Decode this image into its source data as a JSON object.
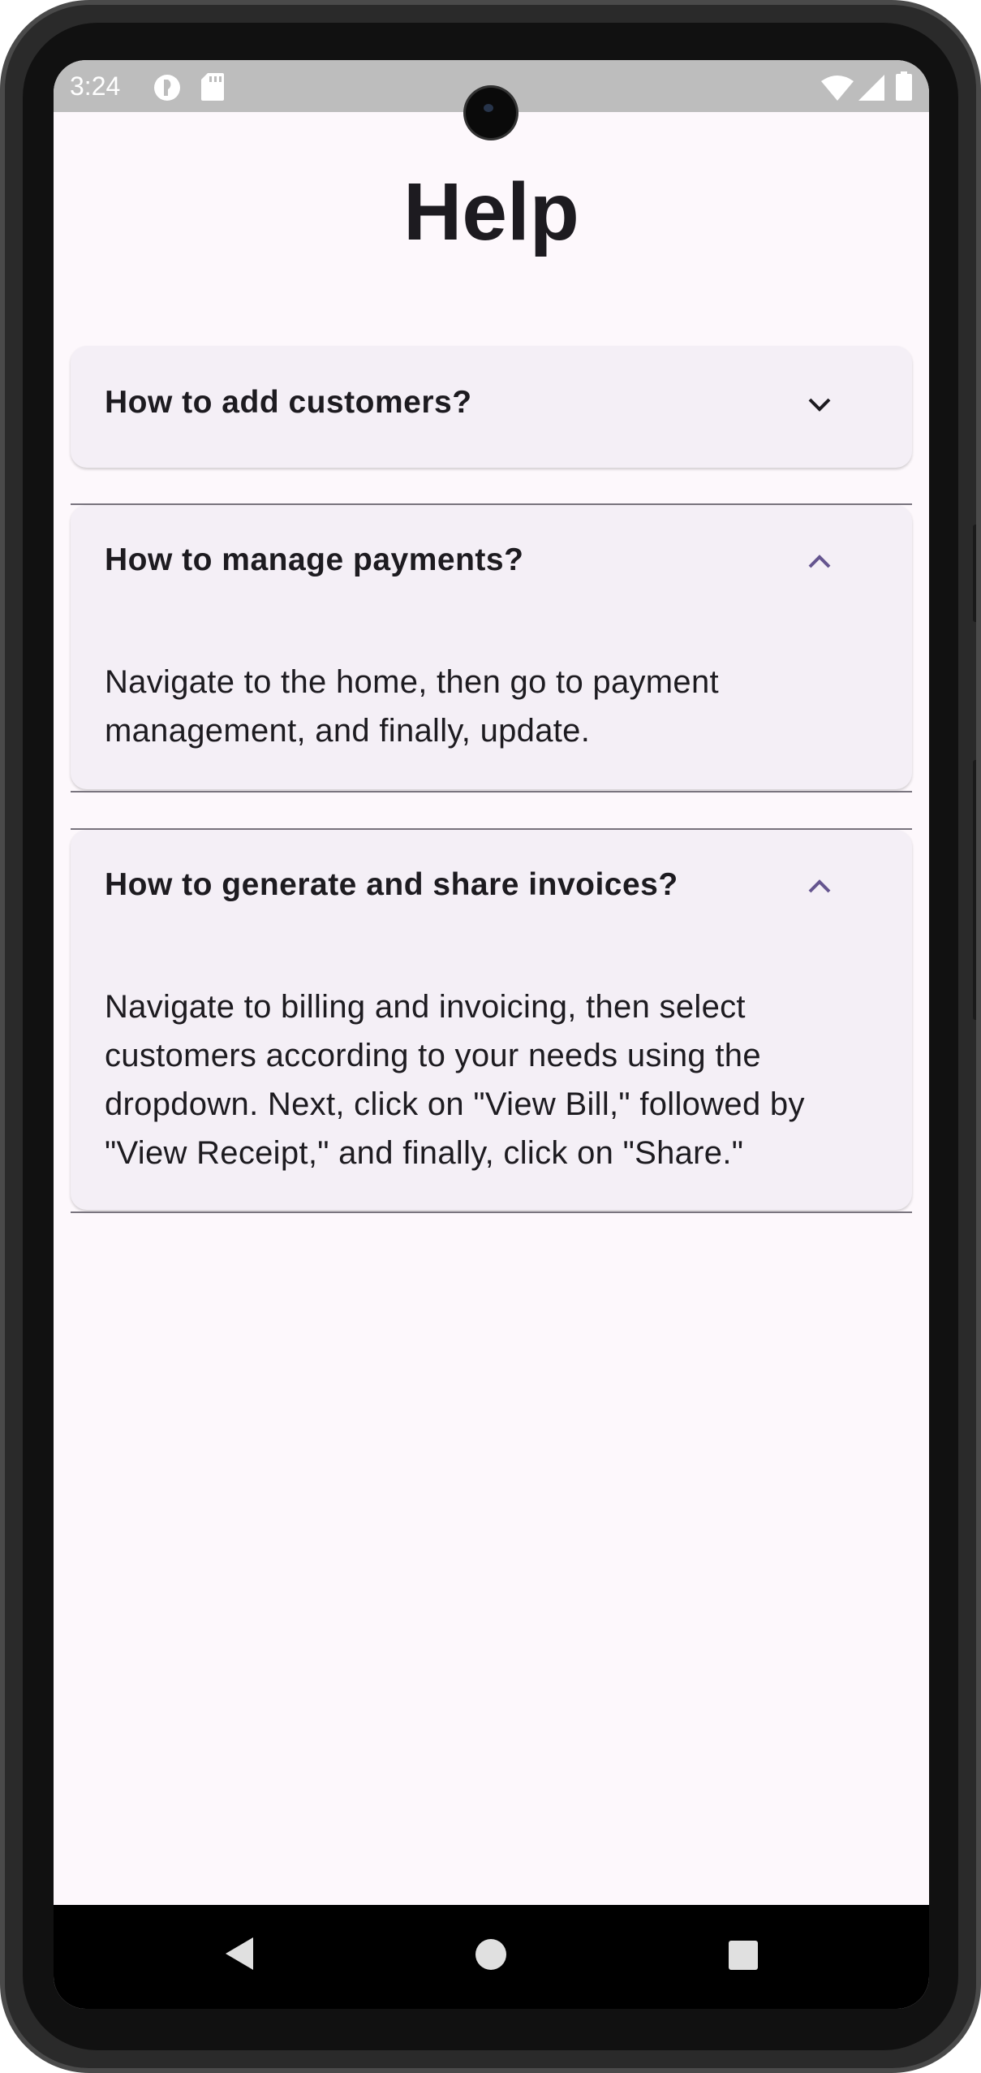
{
  "status_bar": {
    "time": "3:24",
    "icons": [
      "app-notification-icon",
      "sd-card-icon",
      "wifi-icon",
      "cell-signal-icon",
      "battery-icon"
    ]
  },
  "page": {
    "title": "Help"
  },
  "faq": [
    {
      "question": "How to add customers?",
      "expanded": false,
      "answer": ""
    },
    {
      "question": "How to manage payments?",
      "expanded": true,
      "answer": "Navigate to the home, then go to payment management, and finally, update."
    },
    {
      "question": "How to generate and share invoices?",
      "expanded": true,
      "answer": "Navigate to billing and invoicing, then select customers according to your needs using the dropdown. Next, click on \"View Bill,\" followed by \"View Receipt,\" and finally, click on \"Share.\""
    }
  ],
  "nav_bar": {
    "buttons": [
      "back-icon",
      "home-icon",
      "recents-icon"
    ]
  },
  "colors": {
    "background": "#fdf8fc",
    "panel": "#f4eff6",
    "text": "#1d1b20",
    "accent": "#65558f",
    "divider": "#79747e"
  }
}
